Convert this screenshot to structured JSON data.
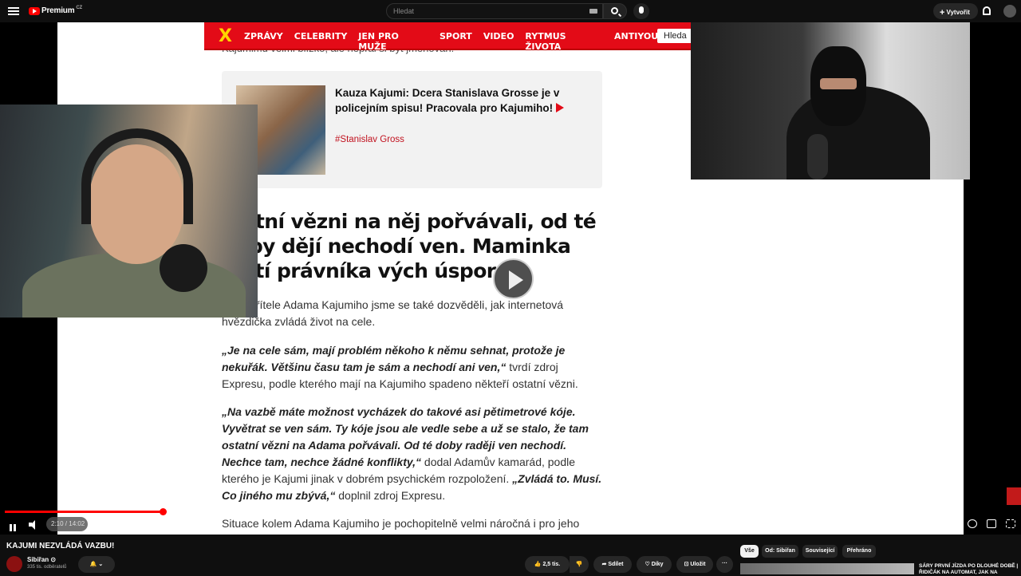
{
  "topbar": {
    "logo_text": "Premium",
    "logo_region": "CZ",
    "search_placeholder": "Hledat",
    "create_label": "Vytvořit"
  },
  "video": {
    "site_nav": [
      "ZPRÁVY",
      "CELEBRITY",
      "JEN PRO MUŽE",
      "SPORT",
      "VIDEO",
      "RYTMUS ŽIVOTA",
      "ANTIYOUTUBER"
    ],
    "site_search_label": "Hleda",
    "cut_text": "Kajumimu velmi blízko, ale nepřál si být jmenován.",
    "related": {
      "title": "Kauza Kajumi: Dcera Stanislava Grosse je v policejním spisu! Pracovala pro Kajumiho!",
      "tag": "#Stanislav Gross"
    },
    "headline": "statní vězni na něj pořvávali, od té doby dějí nechodí ven. Maminka platí právníka vých úspor",
    "para1": "bého přítele Adama Kajumiho jsme se také dozvěděli, jak internetová hvězdička zvládá život na cele.",
    "para2_quote": "„Je na cele sám, mají problém někoho k němu sehnat, protože je nekuřák. Většinu času tam je sám a nechodí ani ven,“",
    "para2_rest": " tvrdí zdroj Expresu, podle kterého mají na Kajumiho spadeno někteří ostatní vězni.",
    "para3_quote": "„Na vazbě máte možnost vycházek do takové asi pětimetrové kóje. Vyvětrat se ven sám. Ty kóje jsou ale vedle sebe a už se stalo, že tam ostatní vězni na Adama pořvávali. Od té doby raději ven nechodí. Nechce tam, nechce žádné konflikty,“",
    "para3_mid": " dodal Adamův kamarád, podle kterého je Kajumi jinak v dobrém psychickém rozpoložení. ",
    "para3_quote2": "„Zvládá to. Musí. Co jiného mu zbývá,“",
    "para3_end": " doplnil zdroj Expresu.",
    "para4": "Situace kolem Adama Kajumiho je pochopitelně velmi náročná i pro jeho",
    "time_display": "2:10 / 14:02",
    "progress_fraction": 0.165
  },
  "below": {
    "title": "KAJUMI NEZVLÁDÁ VAZBU!",
    "channel": "Sibiřan ⊙",
    "subscribers": "335 tis. odběratelů",
    "like_count": "2,5 tis.",
    "share_label": "Sdílet",
    "thanks_label": "Díky",
    "save_label": "Uložit",
    "more_label": "···",
    "chips": [
      "Vše",
      "Od: Sibiřan",
      "Související",
      "Přehráno"
    ],
    "rec_title": "SÁRY PRVNÍ JÍZDA PO DLOUHÉ DOBĚ | ŘIDIČÁK NA AUTOMAT, JAK NA"
  },
  "colors": {
    "site_red": "#e30b17",
    "yt_red": "#ff0000",
    "accent_yellow": "#ffd400"
  }
}
